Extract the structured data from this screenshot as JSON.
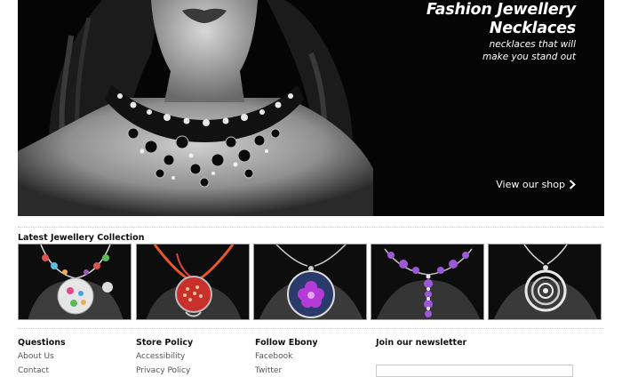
{
  "hero": {
    "title_line1": "Fashion Jewellery",
    "title_line2": "Necklaces",
    "subtitle_line1": "necklaces that will",
    "subtitle_line2": "make you stand out",
    "cta": "View our shop"
  },
  "collection": {
    "title": "Latest Jewellery Collection",
    "items": [
      {
        "name": "multicolour bead pendant necklace"
      },
      {
        "name": "red patterned pendant on orange cord"
      },
      {
        "name": "purple flower round pendant"
      },
      {
        "name": "purple bead necklace"
      },
      {
        "name": "silver circles pendant"
      }
    ]
  },
  "footer": {
    "questions": {
      "heading": "Questions",
      "links": [
        "About Us",
        "Contact"
      ]
    },
    "store_policy": {
      "heading": "Store Policy",
      "links": [
        "Accessibility",
        "Privacy Policy"
      ]
    },
    "follow": {
      "heading": "Follow Ebony",
      "links": [
        "Facebook",
        "Twitter"
      ]
    },
    "newsletter": {
      "heading": "Join our newsletter"
    }
  }
}
